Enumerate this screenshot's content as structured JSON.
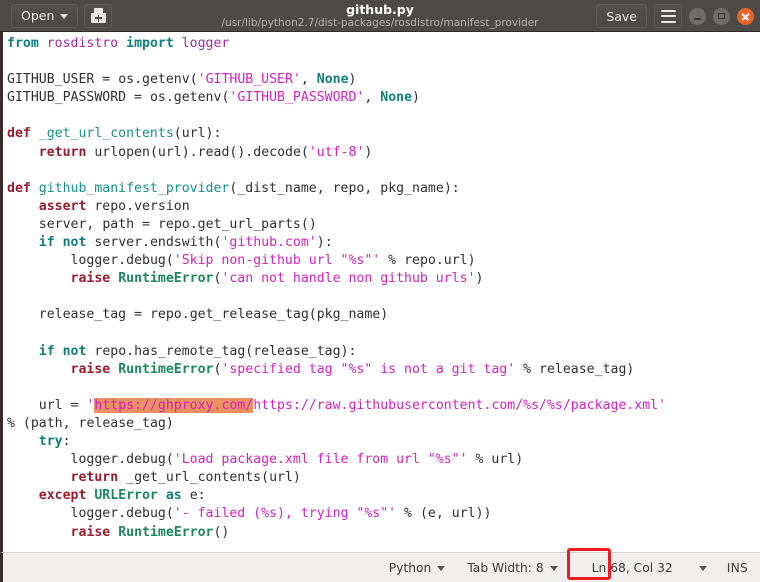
{
  "window": {
    "title": "github.py",
    "subtitle": "/usr/lib/python2.7/dist-packages/rosdistro/manifest_provider",
    "open_label": "Open",
    "save_label": "Save",
    "icons": {
      "save_as": "save-as-icon",
      "menu": "hamburger-menu-icon",
      "minimize": "minimize-icon",
      "maximize": "maximize-icon",
      "close": "close-icon",
      "open_caret": "chevron-down-icon"
    },
    "colors": {
      "titlebar_bg": "#4c4b47",
      "close_btn": "#e9642b",
      "selection_bg": "#e8905f",
      "annotation": "#ee1d1d",
      "statusbar_bg": "#f1efee"
    }
  },
  "editor": {
    "selected_text": "https://ghproxy.com/",
    "lines": [
      "from rosdistro import logger",
      "",
      "GITHUB_USER = os.getenv('GITHUB_USER', None)",
      "GITHUB_PASSWORD = os.getenv('GITHUB_PASSWORD', None)",
      "",
      "def _get_url_contents(url):",
      "    return urlopen(url).read().decode('utf-8')",
      "",
      "def github_manifest_provider(_dist_name, repo, pkg_name):",
      "    assert repo.version",
      "    server, path = repo.get_url_parts()",
      "    if not server.endswith('github.com'):",
      "        logger.debug('Skip non-github url \"%s\"' % repo.url)",
      "        raise RuntimeError('can not handle non github urls')",
      "",
      "    release_tag = repo.get_release_tag(pkg_name)",
      "",
      "    if not repo.has_remote_tag(release_tag):",
      "        raise RuntimeError('specified tag \"%s\" is not a git tag' % release_tag)",
      "",
      "    url = 'https://ghproxy.com/https://raw.githubusercontent.com/%s/%s/package.xml'",
      "% (path, release_tag)",
      "    try:",
      "        logger.debug('Load package.xml file from url \"%s\"' % url)",
      "        return _get_url_contents(url)",
      "    except URLError as e:",
      "        logger.debug('- failed (%s), trying \"%s\"' % (e, url))",
      "        raise RuntimeError()"
    ]
  },
  "statusbar": {
    "language": "Python",
    "tab_width": "Tab Width: 8",
    "position": "Ln 68, Col 32",
    "position_line": "Ln 68,",
    "position_col": "Col 32",
    "insert_mode": "INS"
  }
}
